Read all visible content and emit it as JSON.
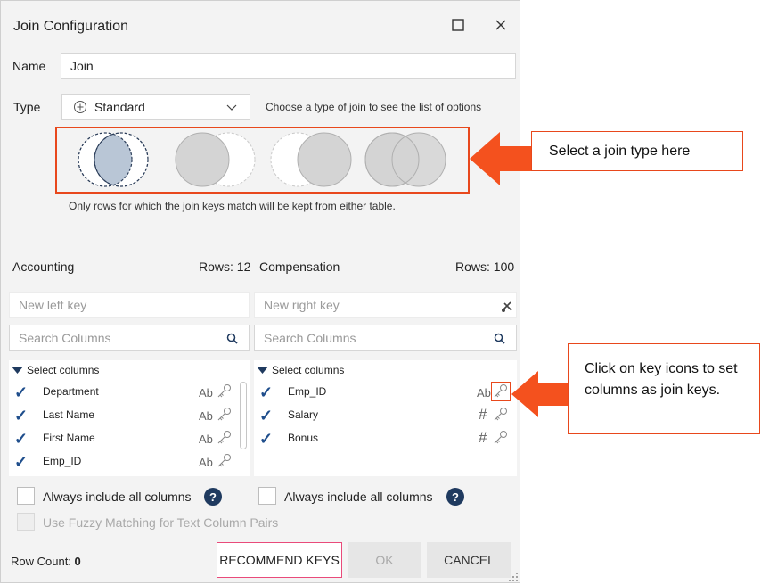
{
  "dialog": {
    "title": "Join Configuration",
    "name_label": "Name",
    "name_value": "Join",
    "type_label": "Type",
    "type_value": "Standard",
    "type_hint": "Choose a type of join to see the list of options",
    "join_description": "Only rows for which the join keys match will be kept from either table."
  },
  "left": {
    "title": "Accounting",
    "rows": "Rows: 12",
    "key_placeholder": "New left key",
    "search_placeholder": "Search Columns",
    "select_columns": "Select columns",
    "columns": [
      {
        "name": "Department",
        "type": "Ab"
      },
      {
        "name": "Last Name",
        "type": "Ab"
      },
      {
        "name": "First Name",
        "type": "Ab"
      },
      {
        "name": "Emp_ID",
        "type": "Ab"
      }
    ],
    "always_include": "Always include all columns"
  },
  "right": {
    "title": "Compensation",
    "rows": "Rows: 100",
    "key_placeholder": "New right key",
    "search_placeholder": "Search Columns",
    "select_columns": "Select columns",
    "columns": [
      {
        "name": "Emp_ID",
        "type": "Ab"
      },
      {
        "name": "Salary",
        "type": "#"
      },
      {
        "name": "Bonus",
        "type": "#"
      }
    ],
    "always_include": "Always include all columns"
  },
  "fuzzy_label": "Use Fuzzy Matching for Text Column Pairs",
  "footer": {
    "row_count_label": "Row Count:",
    "row_count_value": "0",
    "recommend": "RECOMMEND KEYS",
    "ok": "OK",
    "cancel": "CANCEL"
  },
  "callouts": {
    "join_type": "Select a join type here",
    "key_icons": "Click on key icons to set columns as join keys."
  },
  "colors": {
    "accent_orange": "#e8481c",
    "check_blue": "#1f4e8c",
    "help_navy": "#1f3a5f",
    "venn_fill": "#b9c6d6"
  },
  "icons": [
    "maximize-icon",
    "close-icon",
    "plus-circle-icon",
    "chevron-down-icon",
    "search-icon",
    "clear-keys-icon",
    "caret-down-icon",
    "check-icon",
    "key-icon",
    "help-icon",
    "resize-grip-icon"
  ]
}
